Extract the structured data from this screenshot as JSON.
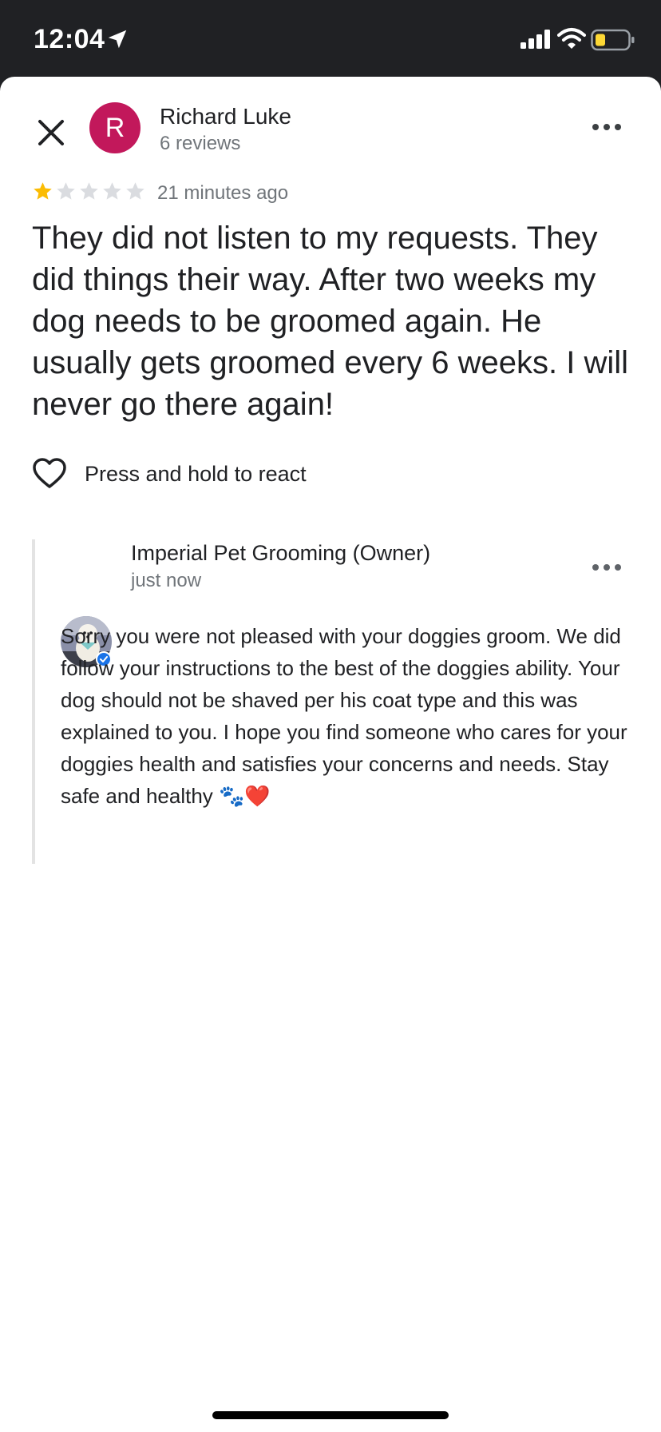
{
  "status_bar": {
    "time": "12:04"
  },
  "icons": {
    "location": "location-arrow-icon",
    "signal": "cellular-signal-icon",
    "wifi": "wifi-icon",
    "battery": "battery-low-icon",
    "close": "close-icon",
    "more": "more-horizontal-icon",
    "star": "star-icon",
    "heart": "heart-outline-icon",
    "verified": "verified-badge-icon"
  },
  "colors": {
    "avatar": "#c2185b",
    "star_filled": "#fbbc04",
    "star_empty": "#dadce0",
    "battery_low": "#fdd835",
    "verified": "#1a73e8"
  },
  "review": {
    "reviewer_initial": "R",
    "reviewer_name": "Richard Luke",
    "reviewer_reviews": "6 reviews",
    "rating": 1,
    "rating_max": 5,
    "time": "21 minutes ago",
    "text": "They did not listen to my requests. They did things their way. After two weeks my dog needs to be groomed again. He usually gets groomed every 6 weeks. I will never go there again!",
    "react_label": "Press and hold to react"
  },
  "owner_reply": {
    "name": "Imperial Pet Grooming (Owner)",
    "time": "just now",
    "text": "Sorry you were not pleased with your doggies groom. We did follow your instructions to the best of the doggies ability. Your dog should not be shaved per his coat type and this was explained to you. I hope you find someone who cares for your doggies health and satisfies your concerns and needs. Stay safe and healthy 🐾❤️"
  }
}
